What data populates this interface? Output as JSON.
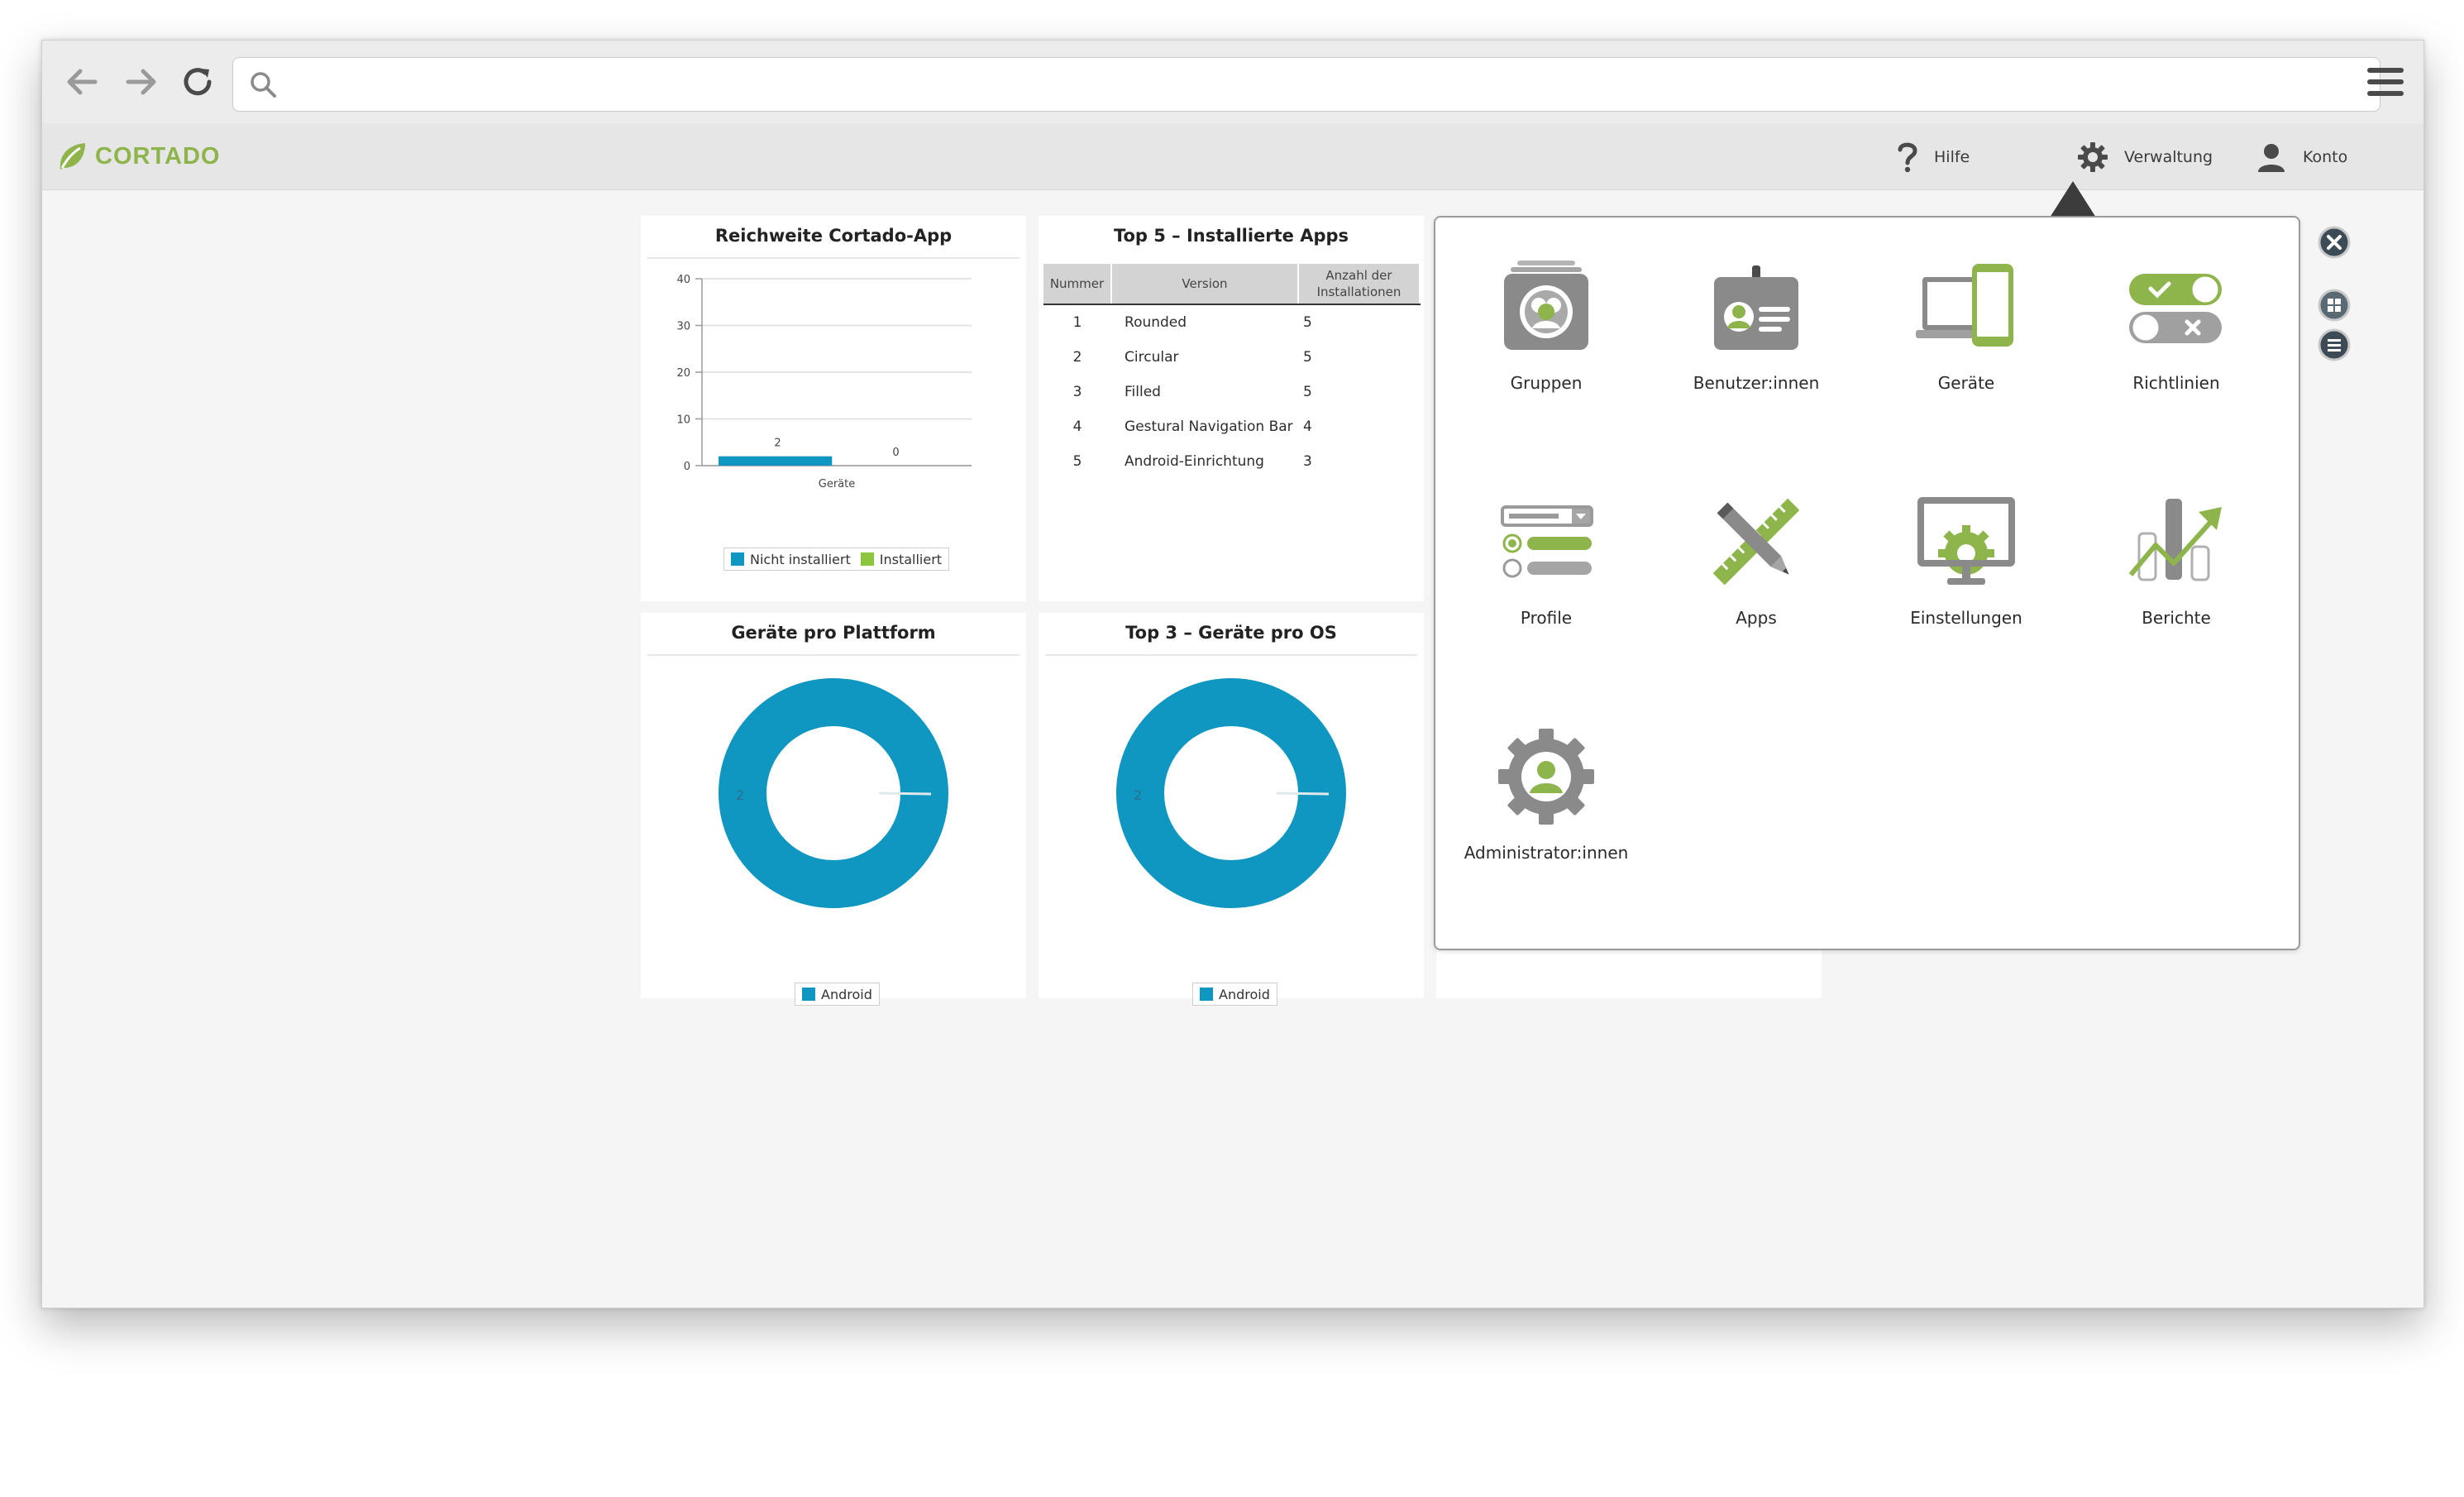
{
  "browser": {
    "url_placeholder": ""
  },
  "header": {
    "logo_text": "CORTADO",
    "help_label": "Hilfe",
    "admin_label": "Verwaltung",
    "account_label": "Konto"
  },
  "tiles": {
    "reach": {
      "title": "Reichweite Cortado-App",
      "legend_not_installed": "Nicht installiert",
      "legend_installed": "Installiert"
    },
    "top_apps": {
      "title": "Top 5 – Installierte Apps",
      "headers": [
        "Nummer",
        "Version",
        "Anzahl der Installationen"
      ],
      "rows": [
        {
          "num": "1",
          "version": "Rounded",
          "count": "5"
        },
        {
          "num": "2",
          "version": "Circular",
          "count": "5"
        },
        {
          "num": "3",
          "version": "Filled",
          "count": "5"
        },
        {
          "num": "4",
          "version": "Gestural Navigation Bar",
          "count": "4"
        },
        {
          "num": "5",
          "version": "Android-Einrichtung",
          "count": "3"
        }
      ]
    },
    "platform": {
      "title": "Geräte pro Plattform",
      "legend": "Android",
      "value_label": "2"
    },
    "os": {
      "title": "Top 3 – Geräte pro OS",
      "legend": "Android",
      "value_label": "2"
    }
  },
  "chart_data": [
    {
      "type": "bar",
      "title": "Reichweite Cortado-App",
      "categories": [
        "Geräte"
      ],
      "series": [
        {
          "name": "Nicht installiert",
          "values": [
            2
          ],
          "color": "#0f96c1"
        },
        {
          "name": "Installiert",
          "values": [
            0
          ],
          "color": "#8cc63e"
        }
      ],
      "ylim": [
        0,
        40
      ],
      "yticks": [
        0,
        10,
        20,
        30,
        40
      ],
      "legend": "bottom"
    },
    {
      "type": "pie",
      "title": "Geräte pro Plattform",
      "slices": [
        {
          "label": "Android",
          "value": 2,
          "color": "#0f96c1"
        }
      ],
      "legend": "bottom"
    },
    {
      "type": "pie",
      "title": "Top 3 – Geräte pro OS",
      "slices": [
        {
          "label": "Android",
          "value": 2,
          "color": "#0f96c1"
        }
      ],
      "legend": "bottom"
    }
  ],
  "admin_menu": {
    "items": [
      {
        "label": "Gruppen"
      },
      {
        "label": "Benutzer:innen"
      },
      {
        "label": "Geräte"
      },
      {
        "label": "Richtlinien"
      },
      {
        "label": "Profile"
      },
      {
        "label": "Apps"
      },
      {
        "label": "Einstellungen"
      },
      {
        "label": "Berichte"
      },
      {
        "label": "Administrator:innen"
      }
    ]
  },
  "colors": {
    "brand_green": "#8db54b",
    "chart_blue": "#0f96c1",
    "chart_green": "#8cc63e",
    "icon_gray": "#8a8a8a"
  },
  "icons": {
    "back": "arrow-left-icon",
    "forward": "arrow-right-icon",
    "reload": "reload-icon",
    "search": "search-icon",
    "menu": "hamburger-icon",
    "help": "question-icon",
    "admin": "gear-icon",
    "account": "user-icon",
    "close": "close-icon",
    "grid_view": "grid-icon",
    "list_view": "list-icon"
  }
}
